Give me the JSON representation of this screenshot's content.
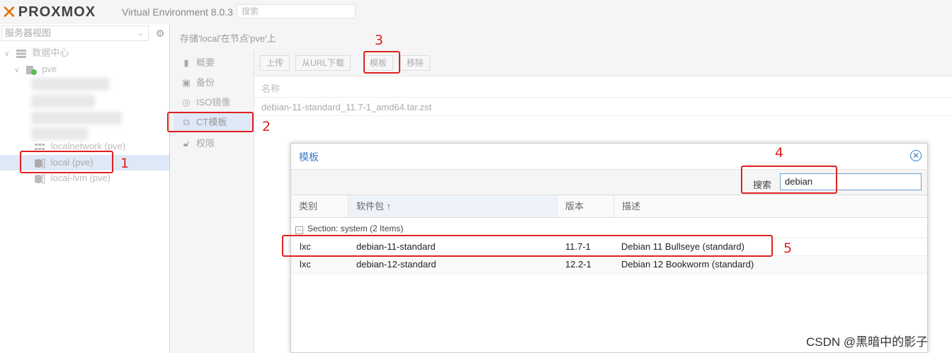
{
  "header": {
    "logo_text": "PROXMOX",
    "version": "Virtual Environment 8.0.3",
    "search_placeholder": "搜索"
  },
  "tree": {
    "view_selector": "服务器视图",
    "datacenter": "数据中心",
    "node": "pve",
    "storages": [
      {
        "label": "localnetwork (pve)"
      },
      {
        "label": "local (pve)"
      },
      {
        "label": "local-lvm (pve)"
      }
    ]
  },
  "breadcrumb": "存储'local'在节点'pve'上",
  "storage_menu": {
    "items": [
      {
        "label": "概要",
        "icon": "book-icon"
      },
      {
        "label": "备份",
        "icon": "floppy-icon"
      },
      {
        "label": "ISO镜像",
        "icon": "disc-icon"
      },
      {
        "label": "CT模板",
        "icon": "container-icon"
      },
      {
        "label": "权限",
        "icon": "unlock-icon"
      }
    ]
  },
  "toolbar": {
    "upload": "上传",
    "download_url": "从URL下载",
    "templates": "模板",
    "remove": "移除"
  },
  "content_grid": {
    "column_name": "名称",
    "rows": [
      "debian-11-standard_11.7-1_amd64.tar.zst"
    ]
  },
  "dialog": {
    "title": "模板",
    "search_label": "搜索",
    "search_value": "debian",
    "columns": [
      "类别",
      "软件包 ↑",
      "版本",
      "描述"
    ],
    "group_label": "Section: system (2 Items)",
    "rows": [
      {
        "type": "lxc",
        "package": "debian-11-standard",
        "version": "11.7-1",
        "description": "Debian 11 Bullseye (standard)"
      },
      {
        "type": "lxc",
        "package": "debian-12-standard",
        "version": "12.2-1",
        "description": "Debian 12 Bookworm (standard)"
      }
    ]
  },
  "annotations": [
    "1",
    "2",
    "3",
    "4",
    "5"
  ],
  "watermark": "CSDN @黑暗中的影子",
  "colors": {
    "brand_orange": "#e57000",
    "accent_blue": "#3b7cc4",
    "annotation_red": "#e02020"
  }
}
